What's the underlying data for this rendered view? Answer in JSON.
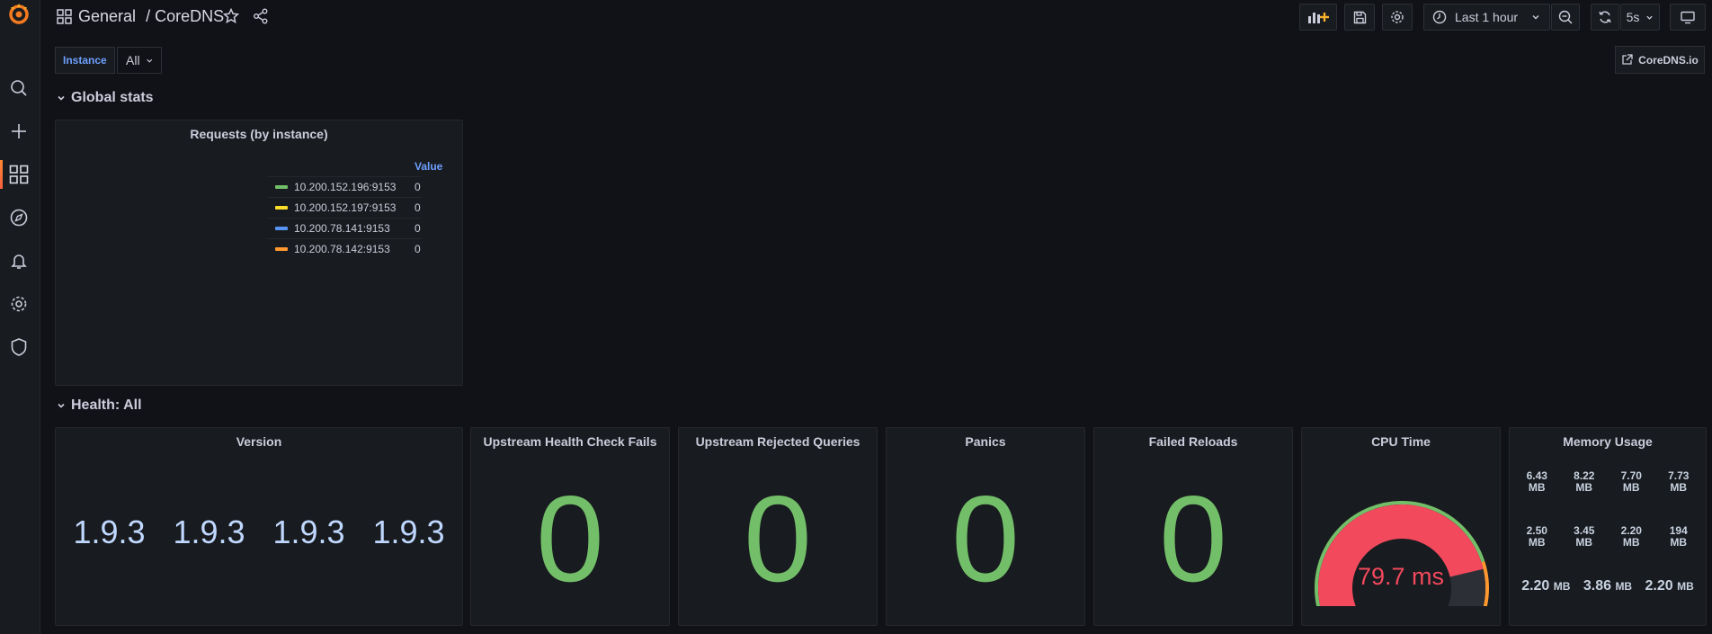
{
  "breadcrumb": {
    "folder": "General",
    "separator": "/",
    "dashboard": "CoreDNS"
  },
  "toolbar": {
    "time_range": "Last 1 hour",
    "refresh_interval": "5s"
  },
  "variables": {
    "instance_label": "Instance",
    "instance_value": "All"
  },
  "links": {
    "coredns": "CoreDNS.io"
  },
  "rows": {
    "global": "Global stats",
    "health": "Health: All"
  },
  "requests_panel": {
    "title": "Requests (by instance)",
    "legend_header": "Value",
    "legend": [
      {
        "name": "10.200.152.196:9153",
        "value": "0",
        "color": "#73bf69"
      },
      {
        "name": "10.200.152.197:9153",
        "value": "0",
        "color": "#fade2a"
      },
      {
        "name": "10.200.78.141:9153",
        "value": "0",
        "color": "#5794f2"
      },
      {
        "name": "10.200.78.142:9153",
        "value": "0",
        "color": "#ff9830"
      }
    ]
  },
  "version_panel": {
    "title": "Version",
    "values": [
      "1.9.3",
      "1.9.3",
      "1.9.3",
      "1.9.3"
    ]
  },
  "stat_panels": [
    {
      "title": "Upstream Health Check Fails",
      "value": "0"
    },
    {
      "title": "Upstream Rejected Queries",
      "value": "0"
    },
    {
      "title": "Panics",
      "value": "0"
    },
    {
      "title": "Failed Reloads",
      "value": "0"
    }
  ],
  "cpu_panel": {
    "title": "CPU Time",
    "value": "79.7 ms",
    "gauge_fraction": 0.82,
    "color": "#f2495c"
  },
  "memory_panel": {
    "title": "Memory Usage",
    "row1": [
      {
        "num": "6.43",
        "unit": "MB"
      },
      {
        "num": "8.22",
        "unit": "MB"
      },
      {
        "num": "7.70",
        "unit": "MB"
      },
      {
        "num": "7.73",
        "unit": "MB"
      }
    ],
    "row2": [
      {
        "num": "2.50",
        "unit": "MB"
      },
      {
        "num": "3.45",
        "unit": "MB"
      },
      {
        "num": "2.20",
        "unit": "MB"
      },
      {
        "num": "194",
        "unit": "MB"
      }
    ],
    "row3": [
      {
        "num": "2.20",
        "unit": "MB"
      },
      {
        "num": "3.86",
        "unit": "MB"
      },
      {
        "num": "2.20",
        "unit": "MB"
      }
    ]
  }
}
